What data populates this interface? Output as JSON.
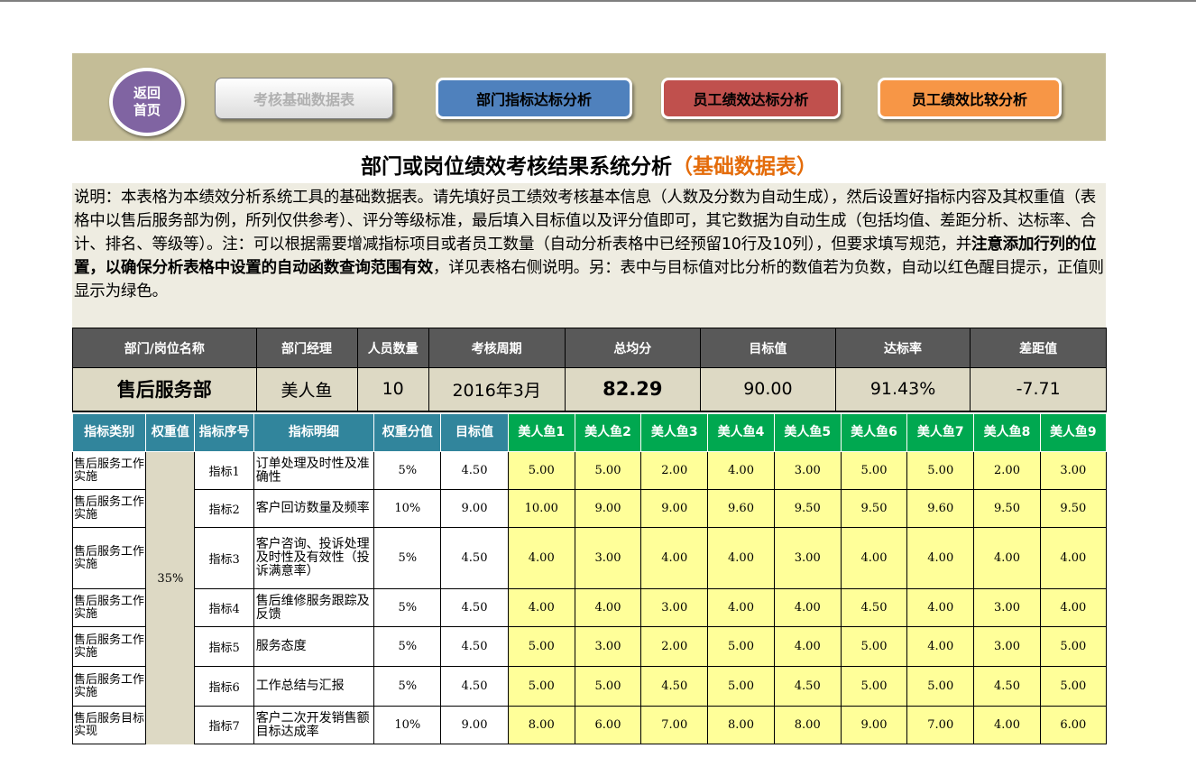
{
  "nav": {
    "home_label": "返回首页",
    "buttons": [
      "考核基础数据表",
      "部门指标达标分析",
      "员工绩效达标分析",
      "员工绩效比较分析"
    ]
  },
  "title": {
    "main": "部门或岗位绩效考核结果系统分析",
    "sub": "（基础数据表）"
  },
  "description": {
    "p1": "说明：本表格为本绩效分析系统工具的基础数据表。请先填好员工绩效考核基本信息（人数及分数为自动生成），然后设置好指标内容及其权重值（表格中以售后服务部为例，所列仅供参考）、评分等级标准，最后填入目标值以及评分值即可，其它数据为自动生成（包括均值、差距分析、达标率、合计、排名、等级等）。注：可以根据需要增减指标项目或者员工数量（自动分析表格中已经预留10行及10列），但要求填写规范，并",
    "bold": "注意添加行列的位置，以确保分析表格中设置的自动函数查询范围有效",
    "p2": "，详见表格右侧说明。另：表中与目标值对比分析的数值若为负数，自动以红色醒目提示，正值则显示为绿色。"
  },
  "summary": {
    "headers": [
      "部门/岗位名称",
      "部门经理",
      "人员数量",
      "考核周期",
      "总均分",
      "目标值",
      "达标率",
      "差距值"
    ],
    "values": [
      "售后服务部",
      "美人鱼",
      "10",
      "2016年3月",
      "82.29",
      "90.00",
      "91.43%",
      "-7.71"
    ]
  },
  "detail": {
    "headers": [
      "指标类别",
      "权重值",
      "指标序号",
      "指标明细",
      "权重分值",
      "目标值"
    ],
    "employees": [
      "美人鱼1",
      "美人鱼2",
      "美人鱼3",
      "美人鱼4",
      "美人鱼5",
      "美人鱼6",
      "美人鱼7",
      "美人鱼8",
      "美人鱼9"
    ],
    "group_weight": "35%",
    "rows": [
      {
        "cat": "售后服务工作实施",
        "no": "指标1",
        "detail": "订单处理及时性及准确性",
        "weight": "5%",
        "target": "4.50",
        "scores": [
          "5.00",
          "5.00",
          "2.00",
          "4.00",
          "3.00",
          "5.00",
          "5.00",
          "2.00",
          "3.00"
        ]
      },
      {
        "cat": "售后服务工作实施",
        "no": "指标2",
        "detail": "客户回访数量及频率",
        "weight": "10%",
        "target": "9.00",
        "scores": [
          "10.00",
          "9.00",
          "9.00",
          "9.60",
          "9.50",
          "9.50",
          "9.60",
          "9.50",
          "9.50"
        ]
      },
      {
        "cat": "售后服务工作实施",
        "no": "指标3",
        "detail": "客户咨询、投诉处理及时性及有效性（投诉满意率）",
        "weight": "5%",
        "target": "4.50",
        "scores": [
          "4.00",
          "3.00",
          "4.00",
          "4.00",
          "3.00",
          "4.00",
          "4.00",
          "4.00",
          "4.00"
        ]
      },
      {
        "cat": "售后服务工作实施",
        "no": "指标4",
        "detail": "售后维修服务跟踪及反馈",
        "weight": "5%",
        "target": "4.50",
        "scores": [
          "4.00",
          "4.00",
          "3.00",
          "4.00",
          "4.00",
          "4.50",
          "4.00",
          "3.00",
          "4.00"
        ]
      },
      {
        "cat": "售后服务工作实施",
        "no": "指标5",
        "detail": "服务态度",
        "weight": "5%",
        "target": "4.50",
        "scores": [
          "5.00",
          "3.00",
          "2.00",
          "5.00",
          "4.00",
          "5.00",
          "4.00",
          "3.00",
          "5.00"
        ]
      },
      {
        "cat": "售后服务工作实施",
        "no": "指标6",
        "detail": "工作总结与汇报",
        "weight": "5%",
        "target": "4.50",
        "scores": [
          "5.00",
          "5.00",
          "4.50",
          "5.00",
          "4.50",
          "5.00",
          "5.00",
          "4.50",
          "5.00"
        ]
      },
      {
        "cat": "售后服务目标实现",
        "no": "指标7",
        "detail": "客户二次开发销售额目标达成率",
        "weight": "10%",
        "target": "9.00",
        "scores": [
          "8.00",
          "6.00",
          "7.00",
          "8.00",
          "8.00",
          "9.00",
          "7.00",
          "4.00",
          "6.00"
        ]
      }
    ]
  }
}
